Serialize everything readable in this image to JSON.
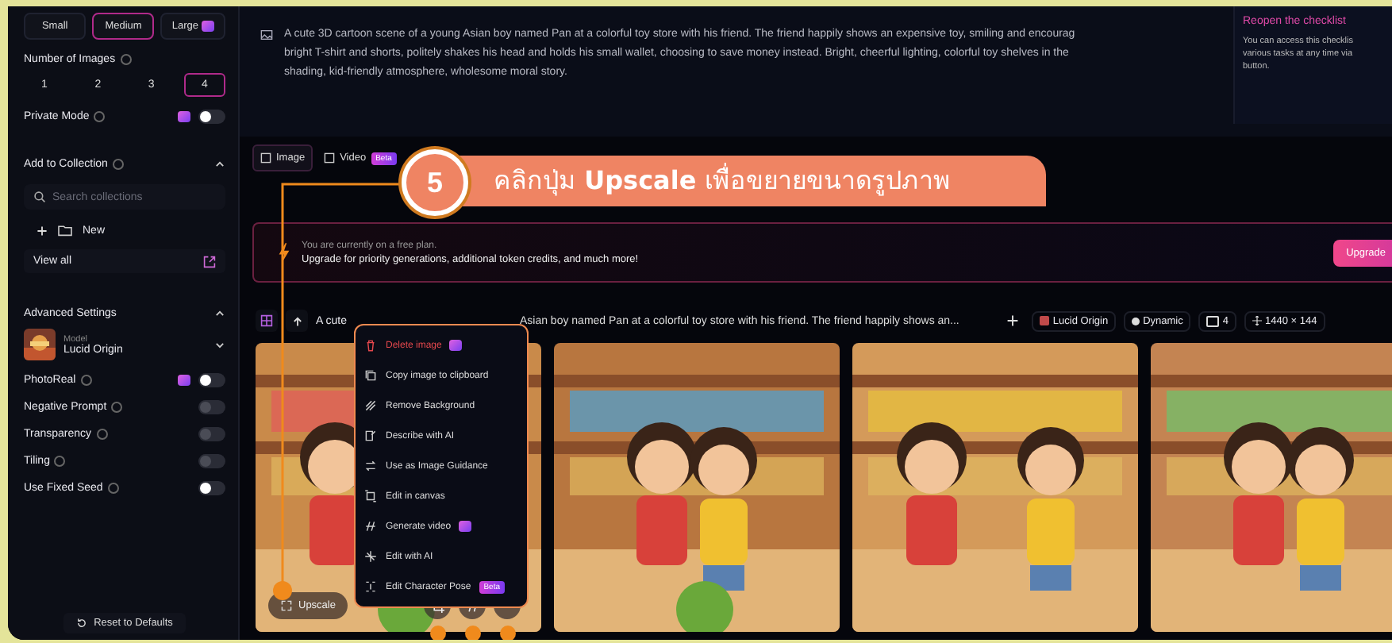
{
  "sidebar": {
    "sizes": [
      {
        "label": "Small",
        "selected": false
      },
      {
        "label": "Medium",
        "selected": true
      },
      {
        "label": "Large",
        "selected": false,
        "premium": true
      }
    ],
    "number_of_images": {
      "label": "Number of Images",
      "options": [
        {
          "label": "1",
          "selected": false
        },
        {
          "label": "2",
          "selected": false
        },
        {
          "label": "3",
          "selected": false
        },
        {
          "label": "4",
          "selected": true
        }
      ]
    },
    "private_mode": {
      "label": "Private Mode",
      "premium": true,
      "on": false,
      "disabled": false
    },
    "collection": {
      "title": "Add to Collection",
      "expanded": true,
      "search_placeholder": "Search collections",
      "new_label": "New",
      "view_all": "View all"
    },
    "advanced": {
      "title": "Advanced Settings",
      "expanded": true,
      "model_caption": "Model",
      "model_name": "Lucid Origin",
      "toggles": [
        {
          "label": "PhotoReal",
          "premium": true,
          "on": false,
          "disabled": false
        },
        {
          "label": "Negative Prompt",
          "on": false,
          "disabled": true
        },
        {
          "label": "Transparency",
          "on": false,
          "disabled": true
        },
        {
          "label": "Tiling",
          "on": false,
          "disabled": true
        },
        {
          "label": "Use Fixed Seed",
          "on": false,
          "disabled": false
        }
      ]
    },
    "reset": "Reset to Defaults"
  },
  "prompt": {
    "lines": [
      "A cute 3D cartoon scene of a young Asian boy named Pan at a colorful toy store with his friend. The friend happily shows an expensive toy, smiling and encourag",
      "bright T-shirt and shorts, politely shakes his head and holds his small wallet, choosing to save money instead. Bright, cheerful lighting, colorful toy shelves in the",
      "shading, kid-friendly atmosphere, wholesome moral story."
    ]
  },
  "checklist": {
    "title": "Reopen the checklist",
    "lines": [
      "You can access this checklis",
      "various tasks at any time via",
      "button."
    ]
  },
  "tabs": [
    {
      "label": "Image",
      "selected": true
    },
    {
      "label": "Video",
      "selected": false,
      "badge": "Beta"
    }
  ],
  "callout": {
    "step": "5",
    "text": "คลิกปุ่ม **Upscale** เพื่อขยายขนาดรูปภาพ"
  },
  "banner": {
    "line1": "You are currently on a free plan.",
    "line2": "Upgrade for priority generations, additional token credits, and much more!",
    "button": "Upgrade"
  },
  "generation": {
    "prompt_start": "A cute",
    "prompt_rest": "Asian boy named Pan at a colorful toy store with his friend. The friend happily shows an...",
    "chips": [
      {
        "kind": "model",
        "label": "Lucid Origin"
      },
      {
        "kind": "style",
        "label": "Dynamic"
      },
      {
        "kind": "count",
        "label": "4"
      },
      {
        "kind": "size",
        "label": "1440 × 144"
      }
    ]
  },
  "image_actions": {
    "upscale": "Upscale"
  },
  "menu": [
    {
      "label": "Delete image",
      "kind": "danger",
      "premium": true
    },
    {
      "label": "Copy image to clipboard",
      "kind": "normal"
    },
    {
      "label": "Remove Background",
      "kind": "normal"
    },
    {
      "label": "Describe with AI",
      "kind": "normal"
    },
    {
      "label": "Use as Image Guidance",
      "kind": "normal"
    },
    {
      "label": "Edit in canvas",
      "kind": "normal"
    },
    {
      "label": "Generate video",
      "kind": "normal",
      "premium": true
    },
    {
      "label": "Edit with AI",
      "kind": "normal"
    },
    {
      "label": "Edit Character Pose",
      "kind": "normal",
      "badge": "Beta"
    }
  ]
}
